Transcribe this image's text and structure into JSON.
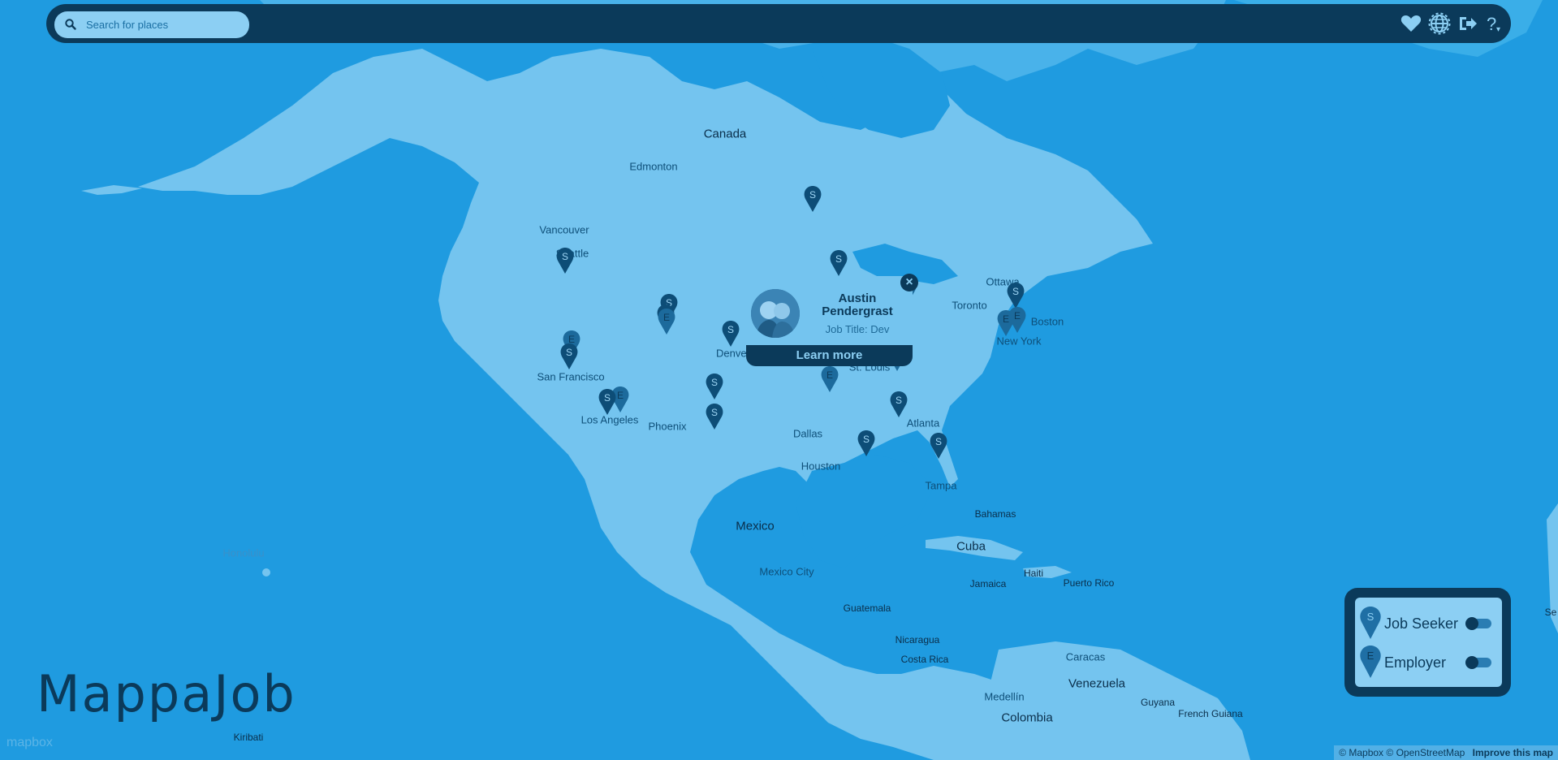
{
  "search": {
    "placeholder": "Search for places"
  },
  "toolbar": {
    "favorites_icon": "heart-icon",
    "language_icon": "globe-icon",
    "logout_icon": "sign-out-icon",
    "help_icon": "help-icon"
  },
  "map": {
    "labels": [
      {
        "key": "canada",
        "text": "Canada",
        "type": "country"
      },
      {
        "key": "edmonton",
        "text": "Edmonton",
        "type": "city"
      },
      {
        "key": "vancouver",
        "text": "Vancouver",
        "type": "city"
      },
      {
        "key": "seattle",
        "text": "Seattle",
        "type": "city"
      },
      {
        "key": "sanfrancisco",
        "text": "San Francisco",
        "type": "city"
      },
      {
        "key": "losangeles",
        "text": "Los Angeles",
        "type": "city"
      },
      {
        "key": "phoenix",
        "text": "Phoenix",
        "type": "city"
      },
      {
        "key": "denver",
        "text": "Denver",
        "type": "city"
      },
      {
        "key": "dallas",
        "text": "Dallas",
        "type": "city"
      },
      {
        "key": "houston",
        "text": "Houston",
        "type": "city"
      },
      {
        "key": "stlouis",
        "text": "St. Louis",
        "type": "city"
      },
      {
        "key": "atlanta",
        "text": "Atlanta",
        "type": "city"
      },
      {
        "key": "tampa",
        "text": "Tampa",
        "type": "city"
      },
      {
        "key": "toronto",
        "text": "Toronto",
        "type": "city"
      },
      {
        "key": "ottawa",
        "text": "Ottawa",
        "type": "city"
      },
      {
        "key": "boston",
        "text": "Boston",
        "type": "city"
      },
      {
        "key": "newyork",
        "text": "New York",
        "type": "city"
      },
      {
        "key": "mexico",
        "text": "Mexico",
        "type": "country"
      },
      {
        "key": "mexicocity",
        "text": "Mexico City",
        "type": "city"
      },
      {
        "key": "guatemala",
        "text": "Guatemala",
        "type": "country2"
      },
      {
        "key": "nicaragua",
        "text": "Nicaragua",
        "type": "country2"
      },
      {
        "key": "costarica",
        "text": "Costa Rica",
        "type": "country2"
      },
      {
        "key": "bahamas",
        "text": "Bahamas",
        "type": "country2"
      },
      {
        "key": "cuba",
        "text": "Cuba",
        "type": "country"
      },
      {
        "key": "jamaica",
        "text": "Jamaica",
        "type": "country2"
      },
      {
        "key": "haiti",
        "text": "Haiti",
        "type": "country2"
      },
      {
        "key": "puertorico",
        "text": "Puerto Rico",
        "type": "country2"
      },
      {
        "key": "caracas",
        "text": "Caracas",
        "type": "city"
      },
      {
        "key": "venezuela",
        "text": "Venezuela",
        "type": "country"
      },
      {
        "key": "medellin",
        "text": "Medellín",
        "type": "city"
      },
      {
        "key": "colombia",
        "text": "Colombia",
        "type": "country"
      },
      {
        "key": "guyana",
        "text": "Guyana",
        "type": "country2"
      },
      {
        "key": "frenchguiana",
        "text": "French Guiana",
        "type": "country2"
      },
      {
        "key": "honolulu",
        "text": "Honolulu",
        "type": "ocean"
      },
      {
        "key": "kiribati",
        "text": "Kiribati",
        "type": "country2"
      },
      {
        "key": "se",
        "text": "Se",
        "type": "country2"
      }
    ],
    "markers": [
      {
        "key": "m1",
        "letter": "S"
      },
      {
        "key": "m2",
        "letter": "S"
      },
      {
        "key": "m3",
        "letter": "S"
      },
      {
        "key": "m4",
        "letter": "E"
      },
      {
        "key": "m5",
        "letter": "S"
      },
      {
        "key": "m6",
        "letter": "S"
      },
      {
        "key": "m7",
        "letter": "E"
      },
      {
        "key": "m8",
        "letter": "S"
      },
      {
        "key": "m9",
        "letter": "E"
      },
      {
        "key": "m10",
        "letter": "S"
      },
      {
        "key": "m11",
        "letter": "E"
      },
      {
        "key": "m12",
        "letter": "S"
      },
      {
        "key": "m13",
        "letter": "S"
      },
      {
        "key": "m14",
        "letter": "E"
      },
      {
        "key": "m15",
        "letter": "S"
      },
      {
        "key": "m16",
        "letter": "S"
      },
      {
        "key": "m17",
        "letter": "S"
      },
      {
        "key": "m18",
        "letter": "S"
      },
      {
        "key": "m19",
        "letter": "S"
      },
      {
        "key": "m20",
        "letter": "E"
      },
      {
        "key": "m21",
        "letter": "E"
      },
      {
        "key": "m22",
        "letter": "E"
      }
    ]
  },
  "popup": {
    "name": "Austin Pendergrast",
    "job_title": "Job Title: Dev",
    "learn_more": "Learn more",
    "close": "×"
  },
  "legend": {
    "job_seeker": {
      "letter": "S",
      "label": "Job Seeker"
    },
    "employer": {
      "letter": "E",
      "label": "Employer"
    }
  },
  "brand": {
    "name": "MappaJob"
  },
  "mapbox_logo": "mapbox",
  "attribution": {
    "mapbox": "© Mapbox",
    "osm": "© OpenStreetMap",
    "improve": "Improve this map"
  },
  "colors": {
    "ocean": "#1f9be0",
    "land": "#74c4ef",
    "dark": "#0b3a5a",
    "light": "#8ccff3"
  }
}
